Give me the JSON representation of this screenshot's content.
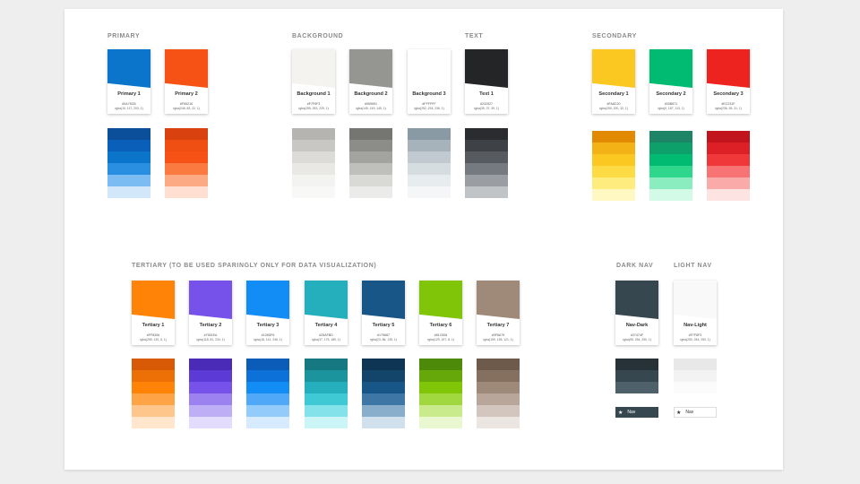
{
  "headings": {
    "primary": "PRIMARY",
    "background": "BACKGROUND",
    "text": "TEXT",
    "secondary": "SECONDARY",
    "tertiary": "TERTIARY (TO BE USED SPARINGLY ONLY FOR DATA VISUALIZATION)",
    "dark_nav": "DARK NAV",
    "light_nav": "LIGHT NAV"
  },
  "cards": [
    {
      "name": "Primary 1",
      "hex": "#0A75CB",
      "rgba": "rgba(10, 117, 203, 1)",
      "color": "#0A75CB"
    },
    {
      "name": "Primary 2",
      "hex": "#F65216",
      "rgba": "rgba(246, 82, 22, 1)",
      "color": "#F65216"
    },
    {
      "name": "Background 1",
      "hex": "#F7F6F3",
      "rgba": "rgba(255, 253, 229, 1)",
      "color": "#F4F3F0"
    },
    {
      "name": "Background 2",
      "hex": "#959591",
      "rgba": "rgba(149, 149, 145, 1)",
      "color": "#959591"
    },
    {
      "name": "Background 3",
      "hex": "#FFFFFF",
      "rgba": "rgba(252, 234, 236, 1)",
      "color": "#FFFFFF"
    },
    {
      "name": "Text 1",
      "hex": "#232527",
      "rgba": "rgba(35, 37, 39, 1)",
      "color": "#232527"
    },
    {
      "name": "Secondary 1",
      "hex": "#FA8C20",
      "rgba": "rgba(250, 200, 32, 1)",
      "color": "#FAC820"
    },
    {
      "name": "Secondary 2",
      "hex": "#00B871",
      "rgba": "rgba(0, 187, 113, 1)",
      "color": "#00BB71"
    },
    {
      "name": "Secondary 3",
      "hex": "#EC231F",
      "rgba": "rgba(236, 35, 31, 1)",
      "color": "#EC231F"
    },
    {
      "name": "Tertiary 1",
      "hex": "#FF8306",
      "rgba": "rgba(255, 130, 6, 1)",
      "color": "#FF8306"
    },
    {
      "name": "Tertiary 2",
      "hex": "#7651EA",
      "rgba": "rgba(118, 81, 234, 1)",
      "color": "#7651EA"
    },
    {
      "name": "Tertiary 3",
      "hex": "#128DF6",
      "rgba": "rgba(18, 141, 246, 1)",
      "color": "#128DF6"
    },
    {
      "name": "Tertiary 4",
      "hex": "#25AFBD",
      "rgba": "rgba(37, 175, 189, 1)",
      "color": "#25AFBD"
    },
    {
      "name": "Tertiary 5",
      "hex": "#175687",
      "rgba": "rgba(23, 86, 135, 1)",
      "color": "#175687"
    },
    {
      "name": "Tertiary 6",
      "hex": "#81C508",
      "rgba": "rgba(129, 197, 8, 1)",
      "color": "#81C508"
    },
    {
      "name": "Tertiary 7",
      "hex": "#9F8A79",
      "rgba": "rgba(159, 138, 121, 1)",
      "color": "#9F8A79"
    },
    {
      "name": "Nav-Dark",
      "hex": "#37474F",
      "rgba": "rgba(55, 254, 250, 1)",
      "color": "#37474F"
    },
    {
      "name": "Nav-Light",
      "hex": "#F7F6F3",
      "rgba": "rgba(250, 254, 250, 1)",
      "color": "#F9F9F9"
    }
  ],
  "shades": [
    [
      "#0B4F9B",
      "#0A5FB8",
      "#0A75CB",
      "#2A8FE0",
      "#7BBDF2",
      "#D2E7FA"
    ],
    [
      "#D9410E",
      "#F04F14",
      "#F65216",
      "#FA7A3F",
      "#FCAA84",
      "#FEDFD1"
    ],
    [
      "#B5B4B0",
      "#C8C7C3",
      "#DCDBD8",
      "#E9E8E5",
      "#F3F3F1",
      "#F8F8F7"
    ],
    [
      "#757671",
      "#8C8D88",
      "#A3A49F",
      "#BFC0BB",
      "#D9D9D6",
      "#EBEBE9"
    ],
    [
      "#8A9AA4",
      "#A6B3BB",
      "#C0CAD0",
      "#D6DDE1",
      "#E7ECEF",
      "#F4F6F7"
    ],
    [
      "#2A2C2F",
      "#3E4145",
      "#575B60",
      "#757A80",
      "#9A9EA3",
      "#C1C4C7"
    ],
    [
      "#E38A05",
      "#F3B215",
      "#FAC820",
      "#FDDB45",
      "#FEEC7E",
      "#FFF8C2"
    ],
    [
      "#1E8466",
      "#0EA06A",
      "#00BB71",
      "#2FD78C",
      "#8AEDBF",
      "#D2FAE6"
    ],
    [
      "#C2141D",
      "#DD1F26",
      "#F0383A",
      "#F87474",
      "#FBAAAA",
      "#FEE3E3"
    ],
    [
      "#D95A06",
      "#ED7006",
      "#FF8306",
      "#FFA347",
      "#FFC68C",
      "#FFE6CC"
    ],
    [
      "#4A2BB8",
      "#5B3AD6",
      "#7651EA",
      "#9B82F0",
      "#BEAEF6",
      "#E3DCFC"
    ],
    [
      "#0A5CB8",
      "#0C71D8",
      "#128DF6",
      "#4FA9F8",
      "#93CCFB",
      "#D6EBFE"
    ],
    [
      "#167982",
      "#1C949E",
      "#25AFBD",
      "#3FC9D5",
      "#84E2EA",
      "#CCF5F8"
    ],
    [
      "#0E3553",
      "#134469",
      "#175687",
      "#3E77A6",
      "#88AECB",
      "#D0E0EC"
    ],
    [
      "#4E8A09",
      "#66A709",
      "#81C508",
      "#A2D83F",
      "#C9EB8C",
      "#EAF8D2"
    ],
    [
      "#6E5A4A",
      "#85705F",
      "#9F8A79",
      "#B7A699",
      "#D2C6BE",
      "#ECE6E2"
    ],
    [
      "#263238",
      "#37474F",
      "#4E6069"
    ],
    [
      "#E8E8E8",
      "#F3F3F3",
      "#FBFBFB"
    ]
  ],
  "nav_chips": [
    {
      "label": "Nav",
      "bg": "#37474F",
      "fg": "#FFFFFF"
    },
    {
      "label": "Nav",
      "bg": "#FFFFFF",
      "fg": "#333333"
    }
  ]
}
